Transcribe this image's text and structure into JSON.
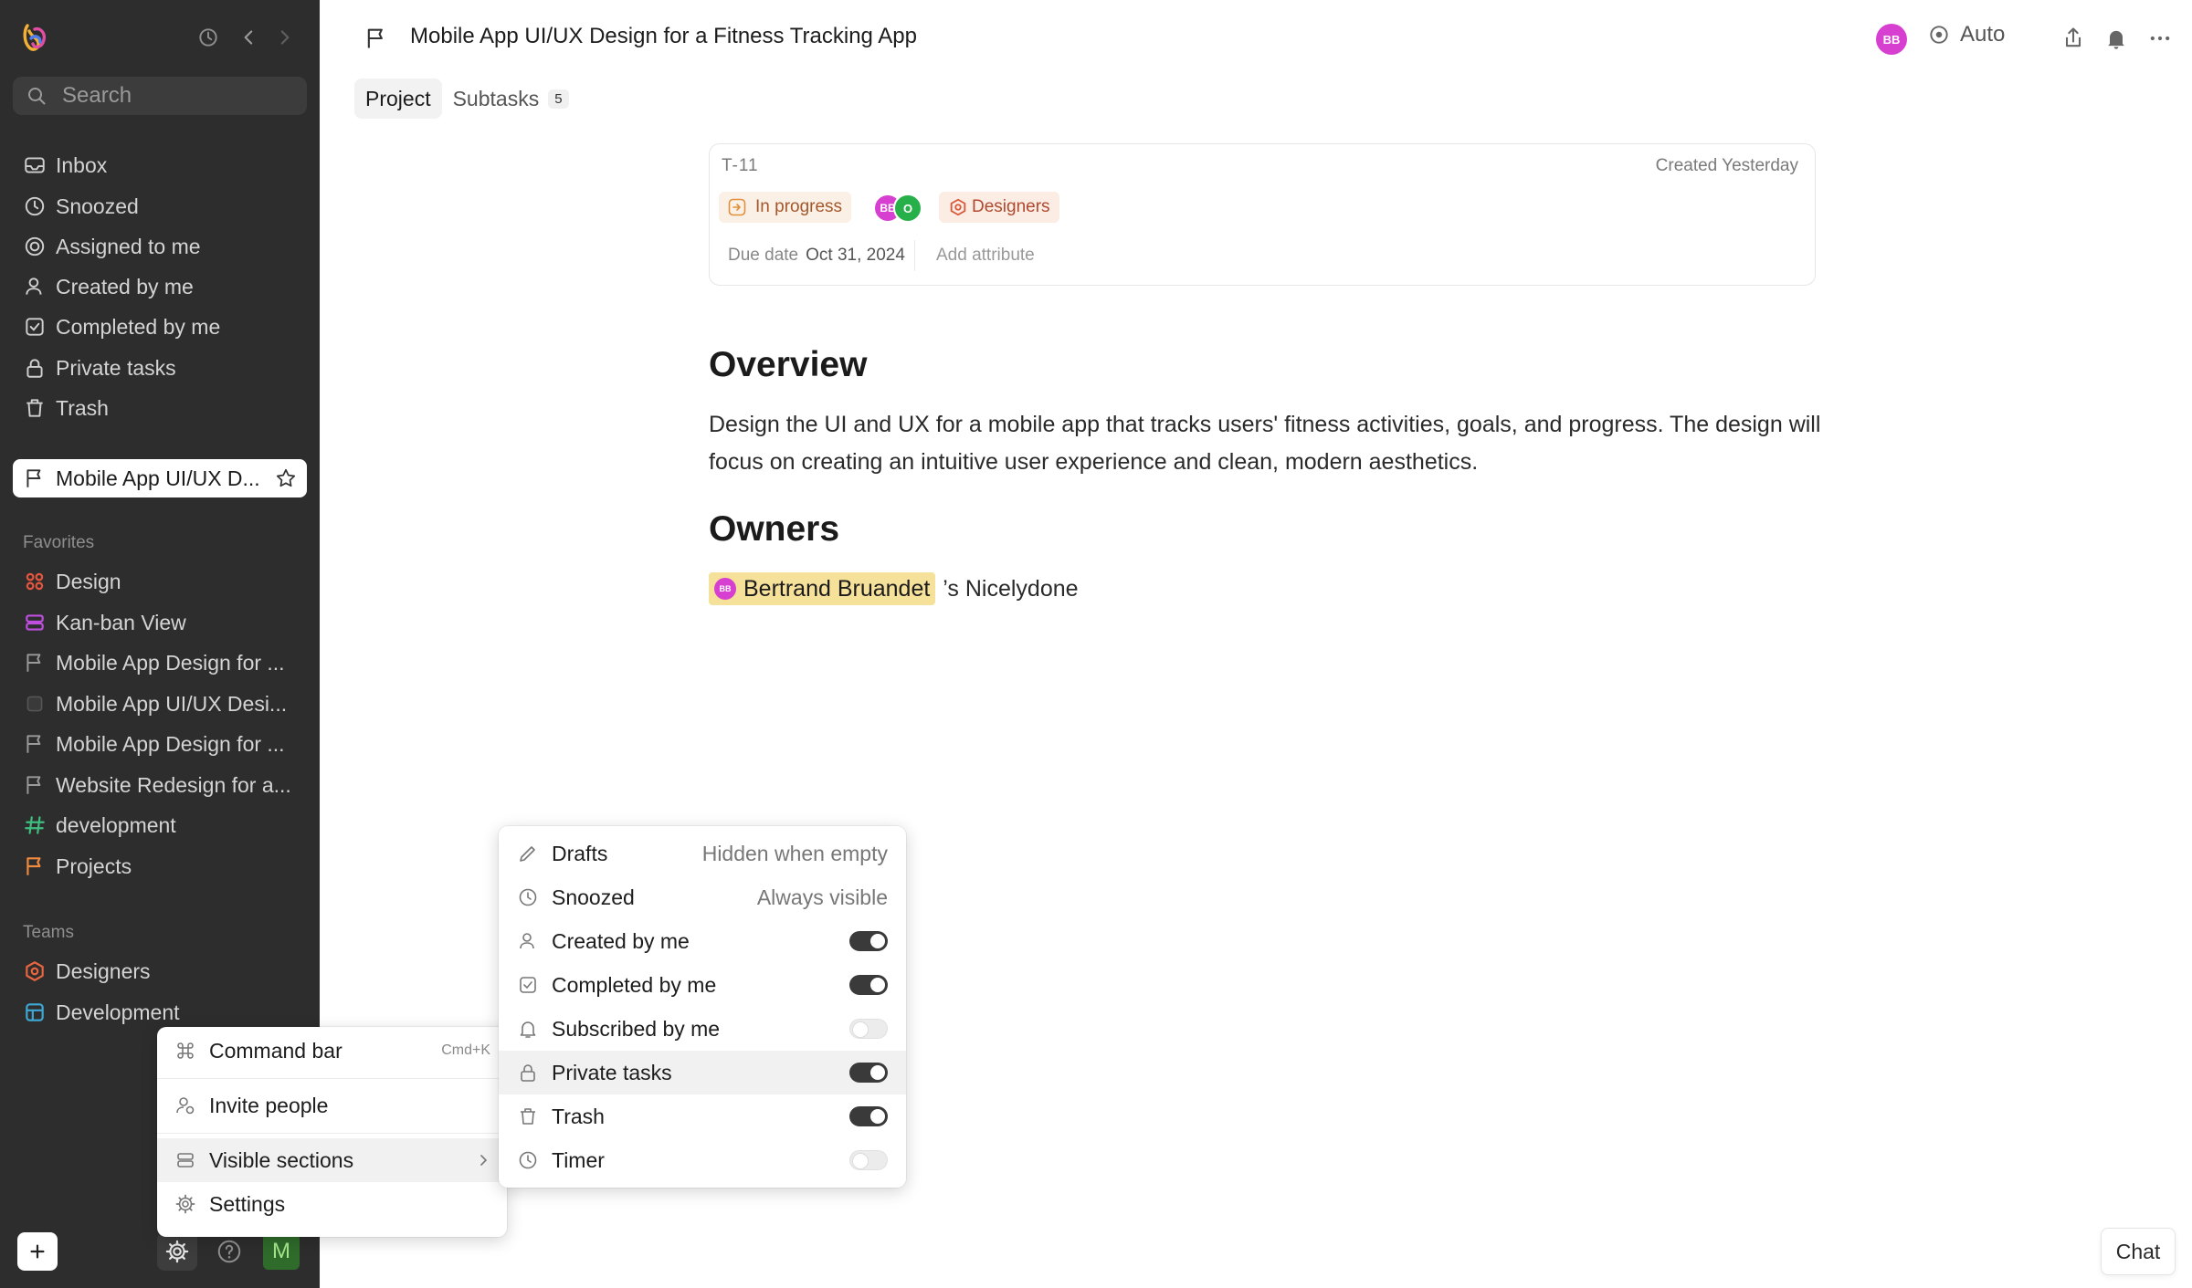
{
  "sidebar": {
    "search_placeholder": "Search",
    "nav": [
      {
        "label": "Inbox",
        "icon": "inbox-icon"
      },
      {
        "label": "Snoozed",
        "icon": "clock-icon"
      },
      {
        "label": "Assigned to me",
        "icon": "target-icon"
      },
      {
        "label": "Created by me",
        "icon": "user-icon"
      },
      {
        "label": "Completed by me",
        "icon": "check-square-icon"
      },
      {
        "label": "Private tasks",
        "icon": "lock-icon"
      },
      {
        "label": "Trash",
        "icon": "trash-icon"
      }
    ],
    "active_page": "Mobile App UI/UX D...",
    "favorites_label": "Favorites",
    "favorites": [
      {
        "label": "Design",
        "icon": "grid-icon",
        "color": "#e8553f"
      },
      {
        "label": "Kan-ban View",
        "icon": "stack-icon",
        "color": "#c04fe0"
      },
      {
        "label": "Mobile App Design for ...",
        "icon": "flag-icon",
        "color": "#9a9a9a"
      },
      {
        "label": "Mobile App UI/UX Desi...",
        "icon": "square-icon",
        "color": "#555555"
      },
      {
        "label": "Mobile App Design for ...",
        "icon": "flag-icon",
        "color": "#9a9a9a"
      },
      {
        "label": "Website Redesign for a...",
        "icon": "flag-icon",
        "color": "#9a9a9a"
      },
      {
        "label": "development",
        "icon": "hash-icon",
        "color": "#3fbf7f"
      },
      {
        "label": "Projects",
        "icon": "flag-icon",
        "color": "#f08a3e"
      }
    ],
    "teams_label": "Teams",
    "teams": [
      {
        "label": "Designers",
        "icon": "team-designers-icon",
        "color": "#e8663f"
      },
      {
        "label": "Development",
        "icon": "team-development-icon",
        "color": "#3fa9d6"
      }
    ],
    "user_initial": "M"
  },
  "header": {
    "title": "Mobile App UI/UX Design for a Fitness Tracking App",
    "avatar_initials": "BB",
    "mode_label": "Auto"
  },
  "tabs": [
    {
      "label": "Project"
    },
    {
      "label": "Subtasks",
      "count": "5"
    }
  ],
  "task": {
    "id": "T-11",
    "created": "Created Yesterday",
    "status": "In progress",
    "assignees": [
      "BB",
      "O"
    ],
    "team": "Designers",
    "due_label": "Due date",
    "due_value": "Oct 31, 2024",
    "add_attribute": "Add attribute"
  },
  "doc": {
    "overview_heading": "Overview",
    "overview_text": "Design the UI and UX for a mobile app that tracks users' fitness activities, goals, and progress. The design will focus on creating an intuitive user experience and clean, modern aesthetics.",
    "owners_heading": "Owners",
    "owner_mention": "Bertrand Bruandet",
    "owner_mention_initials": "BB",
    "owner_suffix": "’s Nicelydone"
  },
  "settings_menu": {
    "command_bar": "Command bar",
    "command_shortcut": "Cmd+K",
    "invite": "Invite people",
    "visible_sections": "Visible sections",
    "settings": "Settings"
  },
  "visible_sections_menu": [
    {
      "label": "Drafts",
      "icon": "pencil-icon",
      "value": "Hidden when empty"
    },
    {
      "label": "Snoozed",
      "icon": "clock-icon",
      "value": "Always visible"
    },
    {
      "label": "Created by me",
      "icon": "user-icon",
      "enabled": true
    },
    {
      "label": "Completed by me",
      "icon": "check-square-icon",
      "enabled": true
    },
    {
      "label": "Subscribed by me",
      "icon": "bell-icon",
      "enabled": false
    },
    {
      "label": "Private tasks",
      "icon": "lock-icon",
      "enabled": true
    },
    {
      "label": "Trash",
      "icon": "trash-icon",
      "enabled": true
    },
    {
      "label": "Timer",
      "icon": "clock-icon",
      "enabled": false
    }
  ],
  "chat_label": "Chat",
  "colors": {
    "sidebar_bg": "#2d2d2d",
    "avatar_pink": "#d63fd0",
    "status_orange": "#a4572a",
    "mention_yellow": "#f6e19a"
  }
}
